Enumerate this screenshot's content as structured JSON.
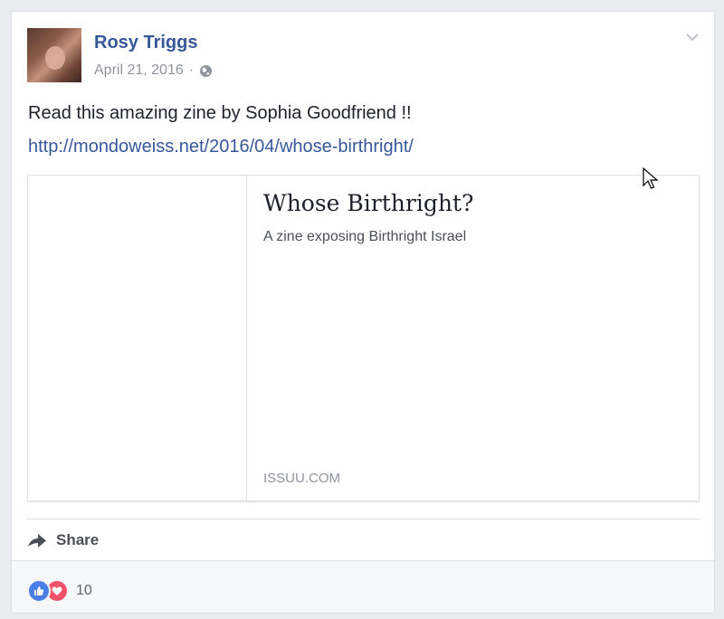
{
  "post": {
    "author": "Rosy Triggs",
    "date": "April 21, 2016",
    "separator": "·",
    "privacy_icon": "globe-icon",
    "text": "Read this amazing zine by Sophia Goodfriend !!",
    "link": "http://mondoweiss.net/2016/04/whose-birthright/"
  },
  "preview": {
    "title": "Whose Birthright?",
    "description": "A zine exposing Birthright Israel",
    "domain": "ISSUU.COM"
  },
  "actions": {
    "share_label": "Share"
  },
  "reactions": {
    "icons": [
      "like-icon",
      "love-icon"
    ],
    "count": "10"
  },
  "colors": {
    "link": "#365899",
    "background": "#e9ebee",
    "like": "#4a7fe8",
    "love": "#f0526b"
  }
}
